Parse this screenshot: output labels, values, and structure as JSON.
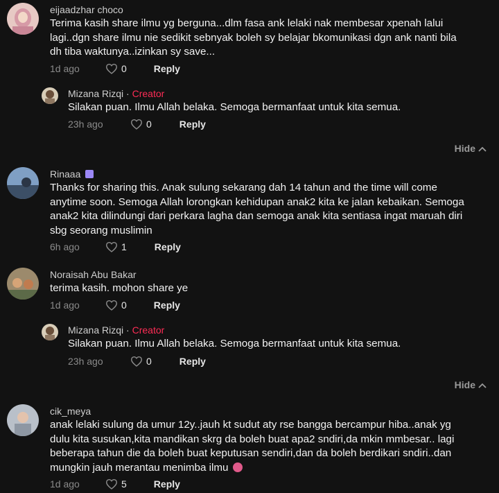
{
  "creator_label": "Creator",
  "hide_label": "Hide",
  "reply_label": "Reply",
  "comments": [
    {
      "author": "eijaadzhar choco",
      "text": "Terima kasih share ilmu yg berguna...dlm fasa ank lelaki nak membesar xpenah lalui lagi..dgn share ilmu nie sedikit sebnyak boleh sy belajar bkomunikasi dgn ank nanti bila dh tiba waktunya..izinkan sy save...",
      "time": "1d ago",
      "likes": "0"
    },
    {
      "author": "Mizana Rizqi",
      "text": "Silakan puan. Ilmu Allah belaka. Semoga bermanfaat untuk kita semua.",
      "time": "23h ago",
      "likes": "0"
    },
    {
      "author": "Rinaaa",
      "text": "Thanks for sharing this. Anak sulung sekarang dah 14 tahun and the time will come anytime soon. Semoga Allah lorongkan kehidupan anak2 kita ke jalan kebaikan. Semoga anak2 kita dilindungi dari perkara lagha dan semoga anak kita sentiasa ingat maruah diri sbg seorang muslimin",
      "time": "6h ago",
      "likes": "1"
    },
    {
      "author": "Noraisah Abu Bakar",
      "text": "terima kasih. mohon share ye",
      "time": "1d ago",
      "likes": "0"
    },
    {
      "author": "Mizana Rizqi",
      "text": "Silakan puan. Ilmu Allah belaka. Semoga bermanfaat untuk kita semua.",
      "time": "23h ago",
      "likes": "0"
    },
    {
      "author": "cik_meya",
      "text": "anak lelaki sulung da umur 12y..jauh kt sudut aty rse bangga bercampur hiba..anak yg dulu kita susukan,kita mandikan skrg da boleh buat apa2 sndiri,da mkin mmbesar.. lagi beberapa tahun die da boleh buat keputusan sendiri,dan da boleh berdikari sndiri..dan mungkin jauh merantau menimba ilmu",
      "time": "1d ago",
      "likes": "5"
    }
  ],
  "colors": {
    "background": "#121212",
    "creator": "#fe2c55",
    "meta": "#8a8a8a"
  }
}
